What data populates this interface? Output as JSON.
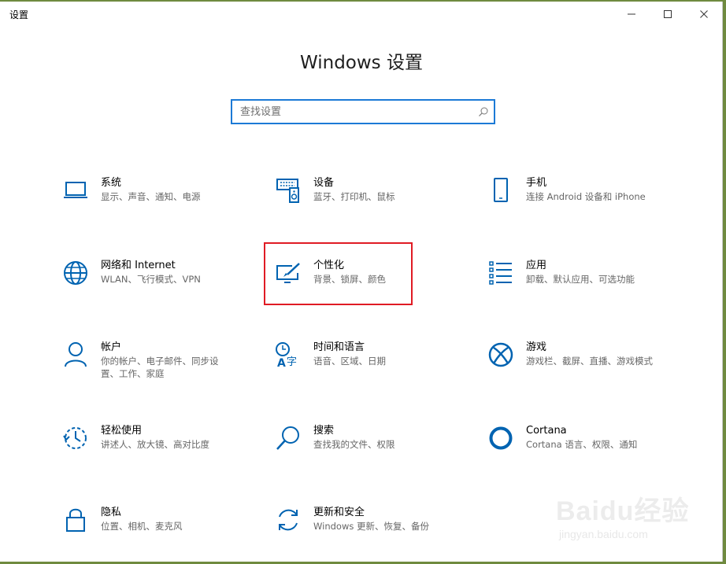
{
  "window": {
    "title": "设置",
    "controls": [
      "minimize",
      "maximize",
      "close"
    ]
  },
  "header": {
    "title": "Windows 设置"
  },
  "search": {
    "placeholder": "查找设置",
    "value": ""
  },
  "tiles": [
    {
      "title": "系统",
      "desc": "显示、声音、通知、电源",
      "icon": "laptop-icon"
    },
    {
      "title": "设备",
      "desc": "蓝牙、打印机、鼠标",
      "icon": "devices-icon"
    },
    {
      "title": "手机",
      "desc": "连接 Android 设备和 iPhone",
      "icon": "phone-icon"
    },
    {
      "title": "网络和 Internet",
      "desc": "WLAN、飞行模式、VPN",
      "icon": "globe-icon"
    },
    {
      "title": "个性化",
      "desc": "背景、锁屏、颜色",
      "icon": "personalization-icon"
    },
    {
      "title": "应用",
      "desc": "卸载、默认应用、可选功能",
      "icon": "apps-list-icon"
    },
    {
      "title": "帐户",
      "desc": "你的帐户、电子邮件、同步设置、工作、家庭",
      "icon": "person-icon"
    },
    {
      "title": "时间和语言",
      "desc": "语音、区域、日期",
      "icon": "time-language-icon"
    },
    {
      "title": "游戏",
      "desc": "游戏栏、截屏、直播、游戏模式",
      "icon": "xbox-icon"
    },
    {
      "title": "轻松使用",
      "desc": "讲述人、放大镜、高对比度",
      "icon": "ease-of-access-icon"
    },
    {
      "title": "搜索",
      "desc": "查找我的文件、权限",
      "icon": "search-icon"
    },
    {
      "title": "Cortana",
      "desc": "Cortana 语言、权限、通知",
      "icon": "cortana-icon"
    },
    {
      "title": "隐私",
      "desc": "位置、相机、麦克风",
      "icon": "lock-icon"
    },
    {
      "title": "更新和安全",
      "desc": "Windows 更新、恢复、备份",
      "icon": "sync-icon"
    }
  ],
  "colors": {
    "accent": "#0063b1",
    "highlight": "#e01b24",
    "search_border": "#1c7ad6"
  },
  "watermark": {
    "logo": "Baidu经验",
    "url": "jingyan.baidu.com"
  }
}
